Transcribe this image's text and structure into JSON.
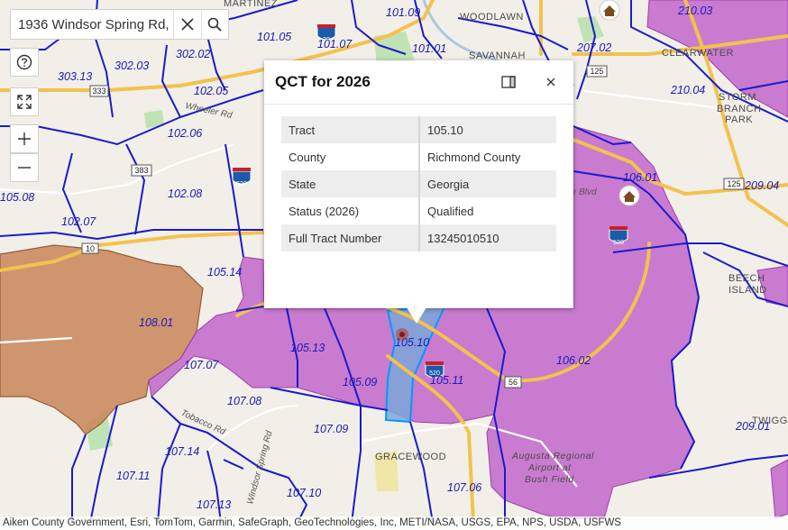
{
  "search": {
    "value": "1936 Windsor Spring Rd,"
  },
  "popup": {
    "title": "QCT for 2026",
    "rows": [
      {
        "label": "Tract",
        "value": "105.10"
      },
      {
        "label": "County",
        "value": "Richmond County"
      },
      {
        "label": "State",
        "value": "Georgia"
      },
      {
        "label": "Status (2026)",
        "value": "Qualified"
      },
      {
        "label": "Full Tract Number",
        "value": "13245010510"
      }
    ]
  },
  "tracts": [
    "210.03",
    "101.09",
    "101.05",
    "101.07",
    "101.01",
    "207.02",
    "303.13",
    "302.03",
    "302.02",
    "102.05",
    "210.04",
    "102.06",
    "102.08",
    "106.01",
    "209.04",
    "102.07",
    "105.08",
    "105.14",
    "108.01",
    "105.13",
    "105.10",
    "106.02",
    "107.07",
    "105.09",
    "105.11",
    "107.08",
    "107.09",
    "209.01",
    "107.14",
    "107.11",
    "107.10",
    "107.06",
    "107.13"
  ],
  "places": [
    "MARTINEZ",
    "WOODLAWN",
    "SAVANNAH",
    "CLEARWATER",
    "STORM",
    "BRANCH",
    "PARK",
    "BEECH",
    "ISLAND",
    "TWIGG",
    "GRACEWOOD",
    "Augusta Regional",
    "Airport at",
    "Bush Field"
  ],
  "streets": [
    "Wheeler Rd",
    "r Blvd",
    "Tobacco Rd",
    "Windsor Spring Rd"
  ],
  "shields": [
    "20",
    "520",
    "520",
    "520",
    "333",
    "383",
    "125",
    "125",
    "56",
    "10"
  ],
  "colors": {
    "qualified": "#c062c9",
    "other": "#c98559",
    "selected": "#7ba7d8",
    "tract_line": "#1a1acd",
    "road": "#f3c24e"
  },
  "attribution": "Aiken County Government, Esri, TomTom, Garmin, SafeGraph, GeoTechnologies, Inc, METI/NASA, USGS, EPA, NPS, USDA, USFWS"
}
